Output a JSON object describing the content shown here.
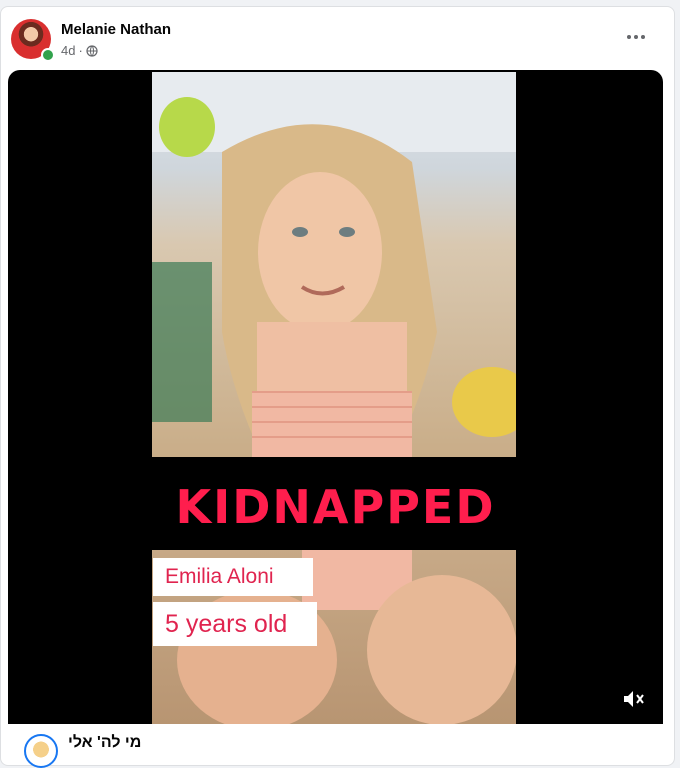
{
  "post": {
    "author": "Melanie Nathan",
    "time": "4d",
    "separator": "·",
    "audience_icon": "globe-icon",
    "more_icon": "more-options-icon"
  },
  "media": {
    "headline": "KIDNAPPED",
    "name_label": "Emilia Aloni",
    "age_label": "5 years old",
    "mute_icon": "muted-speaker-icon"
  },
  "comment": {
    "author": "מי לה' אלי"
  },
  "colors": {
    "headline": "#ff1e4d",
    "label_text": "#e0244f",
    "online": "#31a24c"
  }
}
